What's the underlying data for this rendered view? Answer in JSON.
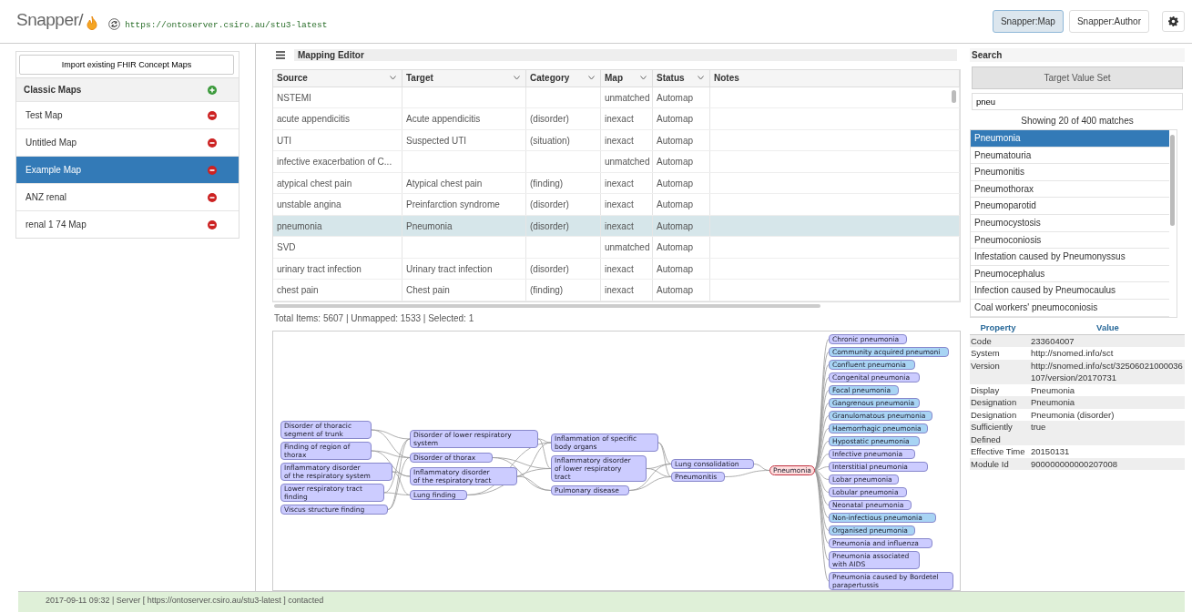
{
  "header": {
    "logo": "Snapper/",
    "server_url": "https://ontoserver.csiro.au/stu3-latest",
    "modes": [
      {
        "label": "Snapper:Map",
        "selected": true
      },
      {
        "label": "Snapper:Author",
        "selected": false
      }
    ]
  },
  "maps_panel": {
    "import_button": "Import existing FHIR Concept Maps",
    "group_title": "Classic Maps",
    "maps": [
      {
        "name": "Test Map",
        "selected": false
      },
      {
        "name": "Untitled Map",
        "selected": false
      },
      {
        "name": "Example Map",
        "selected": true
      },
      {
        "name": "ANZ renal",
        "selected": false
      },
      {
        "name": "renal 1 74 Map",
        "selected": false
      }
    ]
  },
  "editor": {
    "title": "Mapping Editor",
    "columns": [
      {
        "label": "Source",
        "has_menu": true
      },
      {
        "label": "Target",
        "has_menu": true
      },
      {
        "label": "Category",
        "has_menu": true
      },
      {
        "label": "Map",
        "has_menu": true
      },
      {
        "label": "Status",
        "has_menu": true
      },
      {
        "label": "Notes",
        "has_menu": false
      }
    ],
    "rows": [
      {
        "source": "NSTEMI",
        "target": "",
        "category": "",
        "map": "unmatched",
        "status": "Automap",
        "selected": false
      },
      {
        "source": "acute appendicitis",
        "target": "Acute appendicitis",
        "category": "(disorder)",
        "map": "inexact",
        "status": "Automap",
        "selected": false
      },
      {
        "source": "UTI",
        "target": "Suspected UTI",
        "category": "(situation)",
        "map": "inexact",
        "status": "Automap",
        "selected": false
      },
      {
        "source": "infective exacerbation of C...",
        "target": "",
        "category": "",
        "map": "unmatched",
        "status": "Automap",
        "selected": false
      },
      {
        "source": "atypical chest pain",
        "target": "Atypical chest pain",
        "category": "(finding)",
        "map": "inexact",
        "status": "Automap",
        "selected": false
      },
      {
        "source": "unstable angina",
        "target": "Preinfarction syndrome",
        "category": "(disorder)",
        "map": "inexact",
        "status": "Automap",
        "selected": false
      },
      {
        "source": "pneumonia",
        "target": "Pneumonia",
        "category": "(disorder)",
        "map": "inexact",
        "status": "Automap",
        "selected": true
      },
      {
        "source": "SVD",
        "target": "",
        "category": "",
        "map": "unmatched",
        "status": "Automap",
        "selected": false
      },
      {
        "source": "urinary tract infection",
        "target": "Urinary tract infection",
        "category": "(disorder)",
        "map": "inexact",
        "status": "Automap",
        "selected": false
      },
      {
        "source": "chest pain",
        "target": "Chest pain",
        "category": "(finding)",
        "map": "inexact",
        "status": "Automap",
        "selected": false
      }
    ],
    "summary": "Total Items: 5607 | Unmapped: 1533 | Selected: 1"
  },
  "graph": {
    "columns": [
      [
        {
          "label": "Disorder of thoracic\nsegment of trunk",
          "color": "#ccccff",
          "kind": "concept"
        },
        {
          "label": "Finding of region of\nthorax",
          "color": "#ccccff",
          "kind": "concept"
        },
        {
          "label": "Inflammatory disorder\nof the respiratory system",
          "color": "#ccccff",
          "kind": "concept"
        },
        {
          "label": "Lower respiratory tract\nfinding",
          "color": "#ccccff",
          "kind": "concept"
        },
        {
          "label": "Viscus structure finding",
          "color": "#ccccff",
          "kind": "concept"
        }
      ],
      [
        {
          "label": "Disorder of lower respiratory\nsystem",
          "color": "#ccccff",
          "kind": "concept"
        },
        {
          "label": "Disorder of thorax",
          "color": "#ccccff",
          "kind": "concept"
        },
        {
          "label": "Inflammatory disorder\nof the respiratory tract",
          "color": "#ccccff",
          "kind": "concept"
        },
        {
          "label": "Lung finding",
          "color": "#ccccff",
          "kind": "concept"
        }
      ],
      [
        {
          "label": "Inflammation of specific\nbody organs",
          "color": "#ccccff",
          "kind": "concept"
        },
        {
          "label": "Inflammatory disorder\nof lower respiratory\ntract",
          "color": "#ccccff",
          "kind": "concept"
        },
        {
          "label": "Pulmonary disease",
          "color": "#ccccff",
          "kind": "concept"
        }
      ],
      [
        {
          "label": "Lung consolidation",
          "color": "#ccccff",
          "kind": "concept"
        },
        {
          "label": "Pneumonitis",
          "color": "#ccccff",
          "kind": "concept"
        }
      ],
      [
        {
          "label": "Pneumonia",
          "color": "#ffdddd",
          "kind": "focus"
        }
      ],
      [
        {
          "label": "Chronic pneumonia",
          "color": "#ccccff",
          "kind": "concept"
        },
        {
          "label": "Community acquired pneumoni",
          "color": "#a8d4f4",
          "kind": "concept"
        },
        {
          "label": "Confluent pneumonia",
          "color": "#a8d4f4",
          "kind": "concept"
        },
        {
          "label": "Congenital pneumonia",
          "color": "#ccccff",
          "kind": "concept"
        },
        {
          "label": "Focal pneumonia",
          "color": "#a8d4f4",
          "kind": "concept"
        },
        {
          "label": "Gangrenous pneumonia",
          "color": "#a8d4f4",
          "kind": "concept"
        },
        {
          "label": "Granulomatous pneumonia",
          "color": "#a8d4f4",
          "kind": "concept"
        },
        {
          "label": "Haemorrhagic pneumonia",
          "color": "#a8d4f4",
          "kind": "concept"
        },
        {
          "label": "Hypostatic pneumonia",
          "color": "#a8d4f4",
          "kind": "concept"
        },
        {
          "label": "Infective pneumonia",
          "color": "#ccccff",
          "kind": "concept"
        },
        {
          "label": "Interstitial pneumonia",
          "color": "#ccccff",
          "kind": "concept"
        },
        {
          "label": "Lobar pneumonia",
          "color": "#ccccff",
          "kind": "concept"
        },
        {
          "label": "Lobular pneumonia",
          "color": "#ccccff",
          "kind": "concept"
        },
        {
          "label": "Neonatal pneumonia",
          "color": "#ccccff",
          "kind": "concept"
        },
        {
          "label": "Non-infectious pneumonia",
          "color": "#a8d4f4",
          "kind": "concept"
        },
        {
          "label": "Organised pneumonia",
          "color": "#a8d4f4",
          "kind": "concept"
        },
        {
          "label": "Pneumonia and influenza",
          "color": "#ccccff",
          "kind": "concept"
        },
        {
          "label": "Pneumonia associated\nwith AIDS",
          "color": "#ccccff",
          "kind": "concept"
        },
        {
          "label": "Pneumonia caused by Bordetel\nparapertussis",
          "color": "#ccccff",
          "kind": "concept"
        }
      ]
    ]
  },
  "search": {
    "title": "Search",
    "tab": "Target Value Set",
    "query": "pneu",
    "matches": "Showing 20 of 400 matches",
    "results": [
      {
        "label": "Pneumonia",
        "selected": true
      },
      {
        "label": "Pneumatouria",
        "selected": false
      },
      {
        "label": "Pneumonitis",
        "selected": false
      },
      {
        "label": "Pneumothorax",
        "selected": false
      },
      {
        "label": "Pneumoparotid",
        "selected": false
      },
      {
        "label": "Pneumocystosis",
        "selected": false
      },
      {
        "label": "Pneumoconiosis",
        "selected": false
      },
      {
        "label": "Infestation caused by Pneumonyssus",
        "selected": false
      },
      {
        "label": "Pneumocephalus",
        "selected": false
      },
      {
        "label": "Infection caused by Pneumocaulus",
        "selected": false
      },
      {
        "label": "Coal workers' pneumoconiosis",
        "selected": false
      }
    ],
    "properties": {
      "headers": [
        "Property",
        "Value"
      ],
      "rows": [
        {
          "property": "Code",
          "value": "233604007"
        },
        {
          "property": "System",
          "value": "http://snomed.info/sct"
        },
        {
          "property": "Version",
          "value": "http://snomed.info/sct/32506021000036107/version/20170731"
        },
        {
          "property": "Display",
          "value": "Pneumonia"
        },
        {
          "property": "Designation",
          "value": "Pneumonia"
        },
        {
          "property": "Designation",
          "value": "Pneumonia (disorder)"
        },
        {
          "property": "Sufficiently Defined",
          "value": "true"
        },
        {
          "property": "Effective Time",
          "value": "20150131"
        },
        {
          "property": "Module Id",
          "value": "900000000000207008"
        }
      ]
    }
  },
  "status_bar": {
    "text": "2017-09-11 09:32 | Server [ https://ontoserver.csiro.au/stu3-latest ] contacted"
  }
}
